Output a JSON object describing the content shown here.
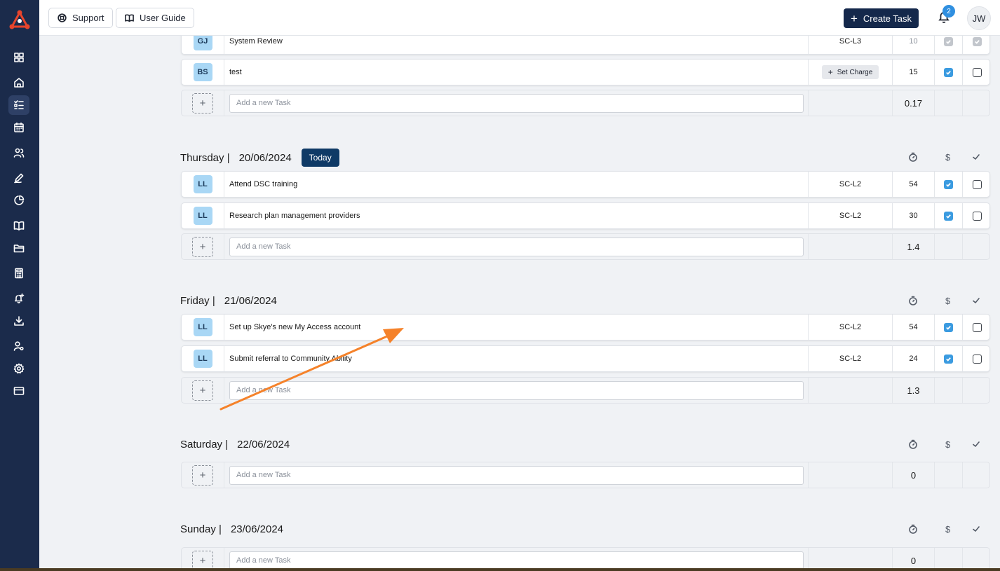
{
  "header": {
    "support_label": "Support",
    "user_guide_label": "User Guide",
    "create_task_label": "Create Task",
    "notification_count": "2",
    "user_initials": "JW"
  },
  "sidebar": {
    "items": [
      {
        "icon": "dashboard-icon"
      },
      {
        "icon": "home-icon"
      },
      {
        "icon": "tasks-icon",
        "active": true
      },
      {
        "icon": "calendar-icon"
      },
      {
        "icon": "users-icon"
      },
      {
        "icon": "pen-icon"
      },
      {
        "icon": "pie-chart-icon"
      },
      {
        "icon": "book-icon"
      },
      {
        "icon": "folder-icon"
      },
      {
        "icon": "calculator-icon"
      },
      {
        "icon": "bell-plus-icon"
      },
      {
        "icon": "download-icon"
      },
      {
        "icon": "user-settings-icon"
      },
      {
        "icon": "settings-icon"
      },
      {
        "icon": "credit-card-icon"
      }
    ]
  },
  "columns": {
    "dollar": "$"
  },
  "add_task_placeholder": "Add a new Task",
  "set_charge_label": "Set Charge",
  "today_label": "Today",
  "days": [
    {
      "tasks": [
        {
          "initials": "GJ",
          "name": "System Review",
          "code": "SC-L3",
          "minutes": "10",
          "charged": "disabled",
          "done": "disabled"
        },
        {
          "initials": "BS",
          "name": "test",
          "code": "",
          "minutes": "15",
          "charged": true,
          "done": false
        }
      ],
      "total": "0.17"
    },
    {
      "day": "Thursday |",
      "date": "20/06/2024",
      "today": true,
      "tasks": [
        {
          "initials": "LL",
          "name": "Attend DSC training",
          "code": "SC-L2",
          "minutes": "54",
          "charged": true,
          "done": false
        },
        {
          "initials": "LL",
          "name": "Research plan management providers",
          "code": "SC-L2",
          "minutes": "30",
          "charged": true,
          "done": false
        }
      ],
      "total": "1.4"
    },
    {
      "day": "Friday |",
      "date": "21/06/2024",
      "tasks": [
        {
          "initials": "LL",
          "name": "Set up Skye's new My Access account",
          "code": "SC-L2",
          "minutes": "54",
          "charged": true,
          "done": false
        },
        {
          "initials": "LL",
          "name": "Submit referral to Community Ability",
          "code": "SC-L2",
          "minutes": "24",
          "charged": true,
          "done": false
        }
      ],
      "total": "1.3"
    },
    {
      "day": "Saturday |",
      "date": "22/06/2024",
      "tasks": [],
      "total": "0"
    },
    {
      "day": "Sunday |",
      "date": "23/06/2024",
      "tasks": [],
      "total": "0"
    }
  ],
  "colors": {
    "sidebar": "#1b2b4b",
    "primary": "#14284b",
    "today_badge": "#0f3a66",
    "checkbox": "#3b9be0",
    "avatar_bg": "#a9d7f5",
    "annotation_arrow": "#f5822a"
  }
}
